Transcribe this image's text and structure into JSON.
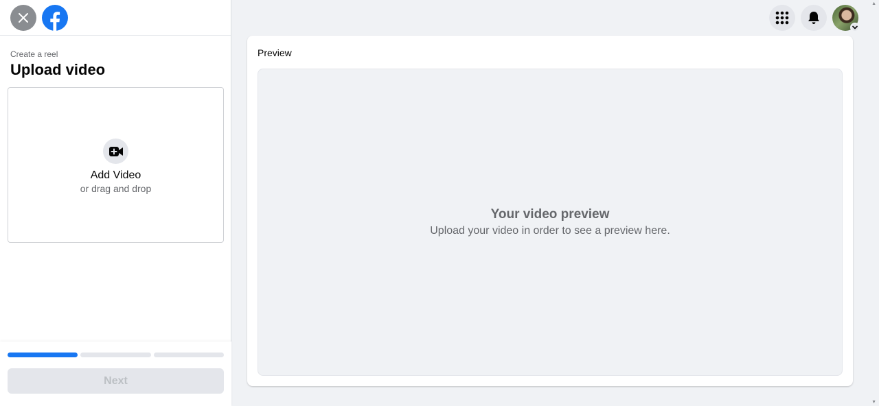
{
  "header": {
    "close_icon": "close-icon",
    "logo_icon": "facebook-logo-icon"
  },
  "page": {
    "subtitle": "Create a reel",
    "title": "Upload video"
  },
  "upload": {
    "icon": "video-plus-icon",
    "label": "Add Video",
    "sublabel": "or drag and drop"
  },
  "progress": {
    "steps": 3,
    "current": 1
  },
  "footer": {
    "next_label": "Next"
  },
  "top_nav": {
    "menu_icon": "grid-menu-icon",
    "notifications_icon": "bell-icon",
    "account_icon": "avatar"
  },
  "preview": {
    "label": "Preview",
    "title": "Your video preview",
    "description": "Upload your video in order to see a preview here."
  },
  "colors": {
    "brand": "#1877f2",
    "background": "#f0f2f5",
    "secondary_text": "#65676b"
  }
}
